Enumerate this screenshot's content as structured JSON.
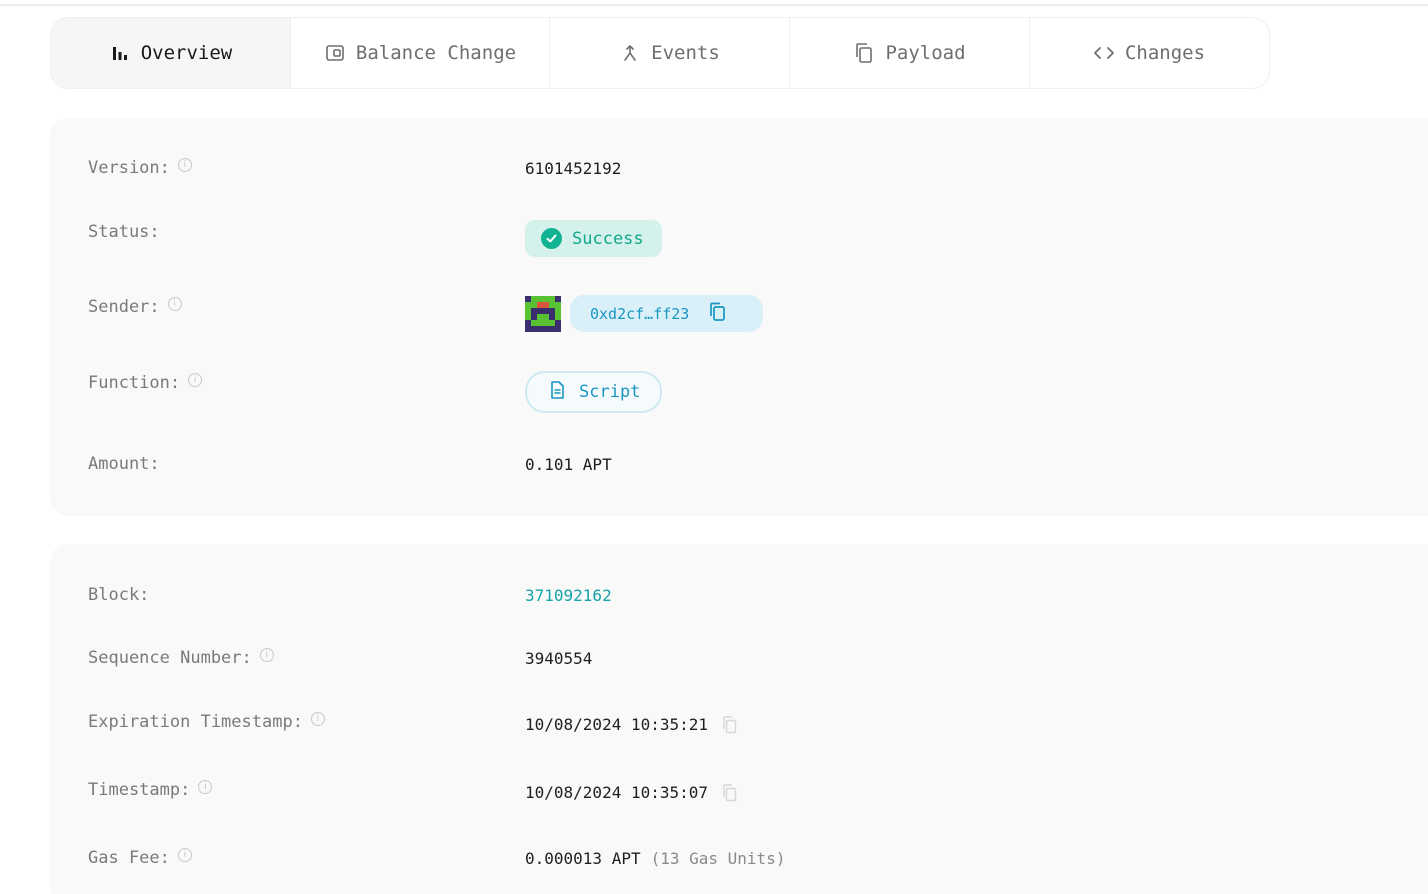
{
  "tabs": [
    {
      "label": "Overview",
      "icon": "bar-chart-icon"
    },
    {
      "label": "Balance Change",
      "icon": "wallet-icon"
    },
    {
      "label": "Events",
      "icon": "merge-icon"
    },
    {
      "label": "Payload",
      "icon": "copy-icon"
    },
    {
      "label": "Changes",
      "icon": "code-icon"
    }
  ],
  "overview": {
    "version_label": "Version:",
    "version_value": "6101452192",
    "status_label": "Status:",
    "status_value": "Success",
    "sender_label": "Sender:",
    "sender_value": "0xd2cf…ff23",
    "function_label": "Function:",
    "function_value": "Script",
    "amount_label": "Amount:",
    "amount_value": "0.101 APT"
  },
  "details": {
    "block_label": "Block:",
    "block_value": "371092162",
    "sequence_label": "Sequence Number:",
    "sequence_value": "3940554",
    "expiration_label": "Expiration Timestamp:",
    "expiration_value": "10/08/2024 10:35:21",
    "timestamp_label": "Timestamp:",
    "timestamp_value": "10/08/2024 10:35:07",
    "gasfee_label": "Gas Fee:",
    "gasfee_value": "0.000013 APT",
    "gasfee_units": "(13 Gas Units)"
  },
  "colors": {
    "accent_teal": "#14a3a6",
    "success_green": "#10b493",
    "link_blue": "#1a96c2"
  }
}
